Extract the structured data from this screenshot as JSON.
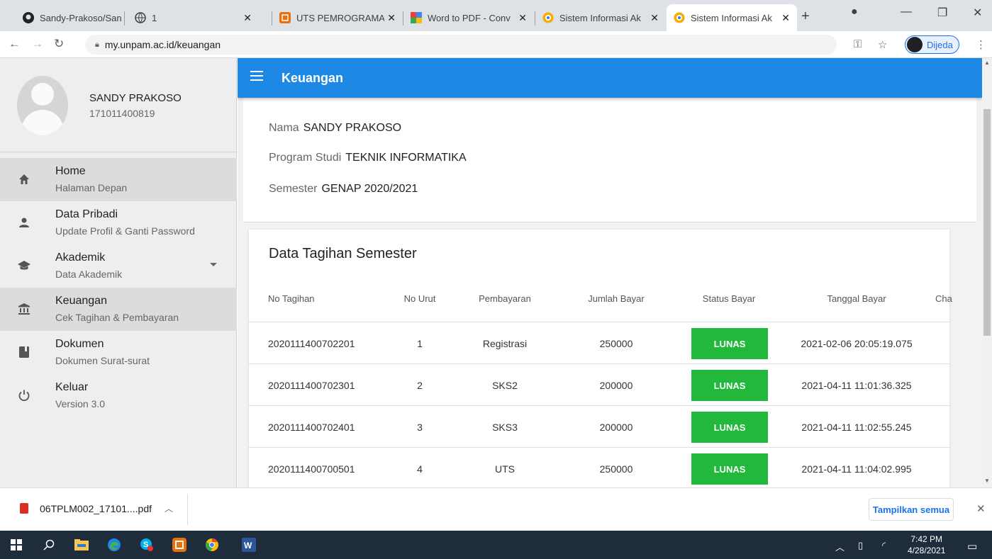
{
  "browser": {
    "tabs": [
      {
        "title": "Sandy-Prakoso/San",
        "icon": "github-icon"
      },
      {
        "title": "1",
        "icon": "globe-icon"
      },
      {
        "title": "UTS PEMROGRAMA",
        "icon": "orange-app-icon"
      },
      {
        "title": "Word to PDF - Conv",
        "icon": "multicolor-icon"
      },
      {
        "title": "Sistem Informasi Ak",
        "icon": "unpam-logo-icon"
      },
      {
        "title": "Sistem Informasi Ak",
        "icon": "unpam-logo-icon",
        "active": true
      }
    ],
    "url": "my.unpam.ac.id/keuangan",
    "profile_label": "Dijeda"
  },
  "sidebar": {
    "user_name": "SANDY PRAKOSO",
    "user_nim": "171011400819",
    "items": [
      {
        "title": "Home",
        "subtitle": "Halaman Depan",
        "icon": "home-icon",
        "selected": true
      },
      {
        "title": "Data Pribadi",
        "subtitle": "Update Profil & Ganti Password",
        "icon": "person-icon"
      },
      {
        "title": "Akademik",
        "subtitle": "Data Akademik",
        "icon": "graduation-cap-icon",
        "expandable": true
      },
      {
        "title": "Keuangan",
        "subtitle": "Cek Tagihan & Pembayaran",
        "icon": "bank-icon",
        "selected": true
      },
      {
        "title": "Dokumen",
        "subtitle": "Dokumen Surat-surat",
        "icon": "book-icon"
      },
      {
        "title": "Keluar",
        "subtitle": "Version 3.0",
        "icon": "power-icon"
      }
    ]
  },
  "appbar": {
    "title": "Keuangan"
  },
  "student_info": {
    "nama_label": "Nama",
    "nama_value": "SANDY PRAKOSO",
    "prodi_label": "Program Studi",
    "prodi_value": "TEKNIK INFORMATIKA",
    "semester_label": "Semester",
    "semester_value": "GENAP 2020/2021"
  },
  "billing": {
    "title": "Data Tagihan Semester",
    "columns": [
      "No Tagihan",
      "No Urut",
      "Pembayaran",
      "Jumlah Bayar",
      "Status Bayar",
      "Tanggal Bayar",
      "Cha"
    ],
    "rows": [
      {
        "no_tagihan": "2020111400702201",
        "no_urut": "1",
        "pembayaran": "Registrasi",
        "jumlah": "250000",
        "status": "LUNAS",
        "tanggal": "2021-02-06 20:05:19.075"
      },
      {
        "no_tagihan": "2020111400702301",
        "no_urut": "2",
        "pembayaran": "SKS2",
        "jumlah": "200000",
        "status": "LUNAS",
        "tanggal": "2021-04-11 11:01:36.325"
      },
      {
        "no_tagihan": "2020111400702401",
        "no_urut": "3",
        "pembayaran": "SKS3",
        "jumlah": "200000",
        "status": "LUNAS",
        "tanggal": "2021-04-11 11:02:55.245"
      },
      {
        "no_tagihan": "2020111400700501",
        "no_urut": "4",
        "pembayaran": "UTS",
        "jumlah": "250000",
        "status": "LUNAS",
        "tanggal": "2021-04-11 11:04:02.995"
      }
    ]
  },
  "downloads": {
    "file_name": "06TPLM002_17101....pdf",
    "show_all": "Tampilkan semua"
  },
  "taskbar": {
    "time": "7:42 PM",
    "date": "4/28/2021"
  },
  "colors": {
    "appbar": "#1e88e5",
    "status_paid": "#21b83c",
    "sidebar_bg": "#eeeeee"
  }
}
